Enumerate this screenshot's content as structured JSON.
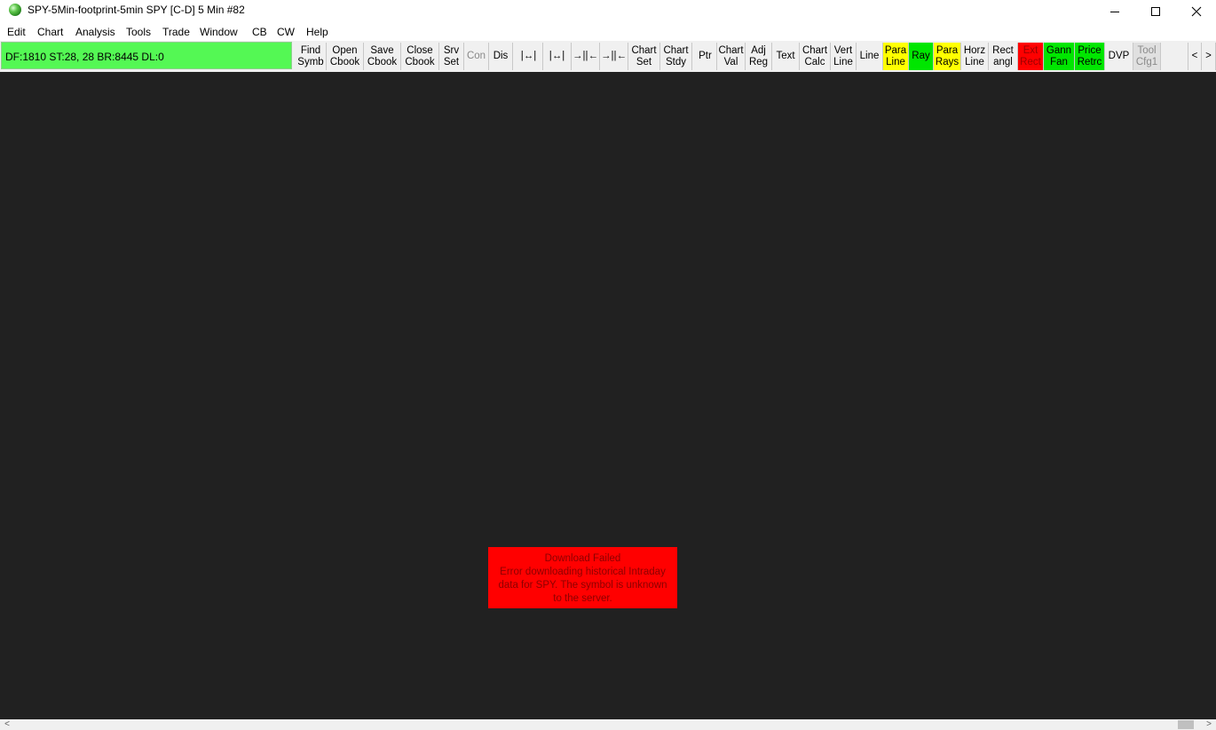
{
  "window": {
    "title": "SPY-5Min-footprint-5min SPY [C-D]  5 Min   #82",
    "minimize_glyph": "—",
    "maximize_glyph": "☐",
    "close_glyph": "✕"
  },
  "menu": [
    "Edit",
    "Chart",
    "Analysis",
    "Tools",
    "Trade",
    "Window",
    "CB",
    "CW",
    "Help"
  ],
  "status": {
    "text": "DF:1810  ST:28, 28  BR:8445  DL:0",
    "color": "#54f854"
  },
  "toolbar": {
    "buttons": [
      {
        "line1": "Find",
        "line2": "Symb"
      },
      {
        "line1": "Open",
        "line2": "Cbook"
      },
      {
        "line1": "Save",
        "line2": "Cbook"
      },
      {
        "line1": "Close",
        "line2": "Cbook"
      },
      {
        "line1": "Srv",
        "line2": "Set"
      },
      {
        "line1": "Con",
        "line2": ""
      },
      {
        "line1": "Dis",
        "line2": ""
      },
      {
        "line1": "|↔|",
        "line2": ""
      },
      {
        "line1": "|↔|",
        "line2": ""
      },
      {
        "line1": "→||←",
        "line2": ""
      },
      {
        "line1": "→||←",
        "line2": ""
      },
      {
        "line1": "Chart",
        "line2": "Set"
      },
      {
        "line1": "Chart",
        "line2": "Stdy"
      },
      {
        "line1": "Ptr",
        "line2": ""
      },
      {
        "line1": "Chart",
        "line2": "Val"
      },
      {
        "line1": "Adj",
        "line2": "Reg"
      },
      {
        "line1": "Text",
        "line2": ""
      },
      {
        "line1": "Chart",
        "line2": "Calc"
      },
      {
        "line1": "Vert",
        "line2": "Line"
      },
      {
        "line1": "Line",
        "line2": ""
      },
      {
        "line1": "Para",
        "line2": "Line"
      },
      {
        "line1": "Ray",
        "line2": ""
      },
      {
        "line1": "Para",
        "line2": "Rays"
      },
      {
        "line1": "Horz",
        "line2": "Line"
      },
      {
        "line1": "Rect",
        "line2": "angl"
      },
      {
        "line1": "Ext",
        "line2": "Rect"
      },
      {
        "line1": "Gann",
        "line2": "Fan"
      },
      {
        "line1": "Price",
        "line2": "Retrc"
      },
      {
        "line1": "DVP",
        "line2": ""
      },
      {
        "line1": "Tool",
        "line2": "Cfg1"
      },
      {
        "line1": "<",
        "line2": ""
      },
      {
        "line1": ">",
        "line2": ""
      }
    ]
  },
  "colors": {
    "chart_bg": "#212121",
    "highlight_yellow": "#ffff00",
    "highlight_green": "#00e600",
    "highlight_red": "#ff0000"
  },
  "error": {
    "line1": "Download Failed",
    "line2": "Error downloading historical Intraday",
    "line3": "data for SPY.  The symbol is unknown",
    "line4": "to the server."
  },
  "scrollbar": {
    "left_arrow": "<",
    "right_arrow": ">"
  }
}
